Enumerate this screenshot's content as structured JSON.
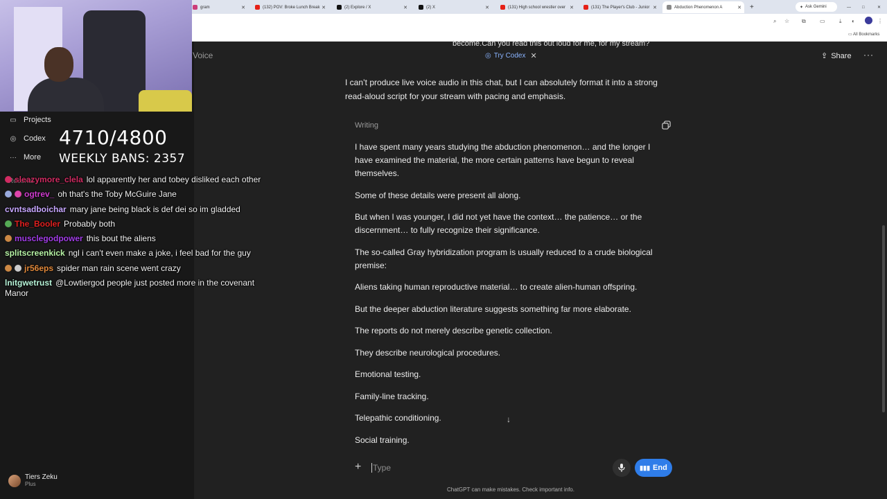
{
  "browser": {
    "tabs": [
      {
        "label": "gram",
        "color": "#cc3d7a"
      },
      {
        "label": "(132) POV: Broke Lunch Break",
        "color": "#e62117"
      },
      {
        "label": "(2) Explore / X",
        "color": "#111111"
      },
      {
        "label": "(2) X",
        "color": "#111111"
      },
      {
        "label": "(131) High school wrestler over",
        "color": "#e62117"
      },
      {
        "label": "(131) The Player's Club - Junior",
        "color": "#e62117"
      },
      {
        "label": "Abduction Phenomenon A",
        "color": "#888888"
      }
    ],
    "new_tab": "+",
    "ask_gemini": "Ask Gemini",
    "bookmarks_label": "All Bookmarks"
  },
  "overlay": {
    "counter": "4710/4800",
    "weekly_bans": "WEEKLY BANS: 2357",
    "chat": [
      {
        "user": "sleazymore_clela",
        "color": "#d12b62",
        "text": "lol apparently her and tobey disliked each other"
      },
      {
        "user": "ogtrev_",
        "color": "#d03cd0",
        "text": "oh that's the Toby McGuire Jane"
      },
      {
        "user": "cvntsadboichar",
        "color": "#c7a7ff",
        "text": "mary jane being black is def dei so im gladded"
      },
      {
        "user": "The_Booler",
        "color": "#e02020",
        "text": "Probably both"
      },
      {
        "user": "musclegodpower",
        "color": "#a23de8",
        "text": "this bout the aliens"
      },
      {
        "user": "splitscreenkick",
        "color": "#b8f5a6",
        "text": "ngl i can't even make a joke, i feel bad for the guy"
      },
      {
        "user": "jr56eps",
        "color": "#e0883a",
        "text": "spider man rain scene went crazy"
      },
      {
        "user": "lnitgwetrust",
        "color": "#b8f5d9",
        "text": "@Lowtiergod people just posted more in the covenant Manor"
      }
    ]
  },
  "sidebar": {
    "items": [
      {
        "label": "Projects",
        "icon": "folder-icon"
      },
      {
        "label": "Codex",
        "icon": "codex-icon"
      },
      {
        "label": "More",
        "icon": "dots-icon"
      }
    ],
    "recents_label": "Recents",
    "user": {
      "name": "Tiers Zeku",
      "plan": "Plus"
    }
  },
  "header": {
    "voice_label": "Voice",
    "prev_message": "become.Can you read this out loud for me, for my stream?",
    "try_codex": "Try Codex",
    "share": "Share"
  },
  "assistant": {
    "intro": "I can’t produce live voice audio in this chat, but I can absolutely format it into a strong read-aloud script for your stream with pacing and emphasis.",
    "writing_label": "Writing",
    "paragraphs": [
      "I have spent many years studying the abduction phenomenon… and the longer I have examined the material, the more certain patterns have begun to reveal themselves.",
      "Some of these details were present all along.",
      "But when I was younger, I did not yet have the context… the patience… or the discernment… to fully recognize their significance.",
      "The so-called Gray hybridization program is usually reduced to a crude biological premise:",
      "Aliens taking human reproductive material… to create alien-human offspring.",
      "But the deeper abduction literature suggests something far more elaborate.",
      "The reports do not merely describe genetic collection.",
      "They describe neurological procedures.",
      "Emotional testing.",
      "Family-line tracking.",
      "Telepathic conditioning.",
      "Social training."
    ]
  },
  "composer": {
    "placeholder": "Type",
    "end_label": "End",
    "disclaimer": "ChatGPT can make mistakes. Check important info."
  }
}
